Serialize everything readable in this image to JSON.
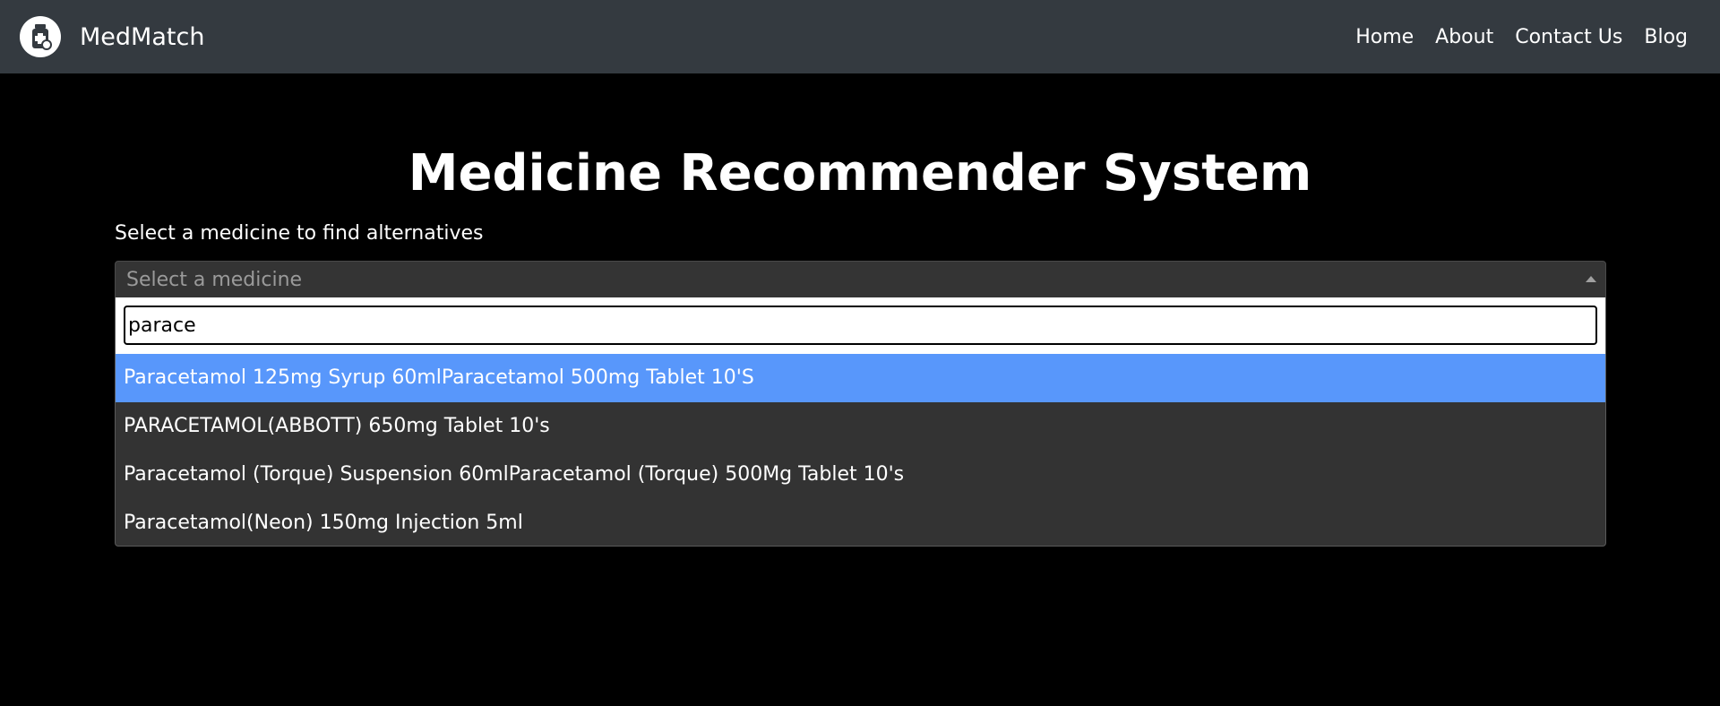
{
  "navbar": {
    "brand_name": "MedMatch",
    "brand_icon": "medicine-bottle-icon",
    "links": [
      "Home",
      "About",
      "Contact Us",
      "Blog"
    ]
  },
  "main": {
    "title": "Medicine Recommender System",
    "label": "Select a medicine to find alternatives",
    "select": {
      "placeholder": "Select a medicine"
    },
    "dropdown": {
      "search_value": "parace",
      "options": [
        "Paracetamol 125mg Syrup 60mlParacetamol 500mg Tablet 10'S",
        "PARACETAMOL(ABBOTT) 650mg Tablet 10's",
        "Paracetamol (Torque) Suspension 60mlParacetamol (Torque) 500Mg Tablet 10's",
        "Paracetamol(Neon) 150mg Injection 5ml"
      ],
      "highlighted_index": 0
    }
  },
  "colors": {
    "navbar_bg": "#343a40",
    "page_bg": "#000000",
    "highlight": "#5897fb",
    "dropdown_bg": "#333333"
  }
}
